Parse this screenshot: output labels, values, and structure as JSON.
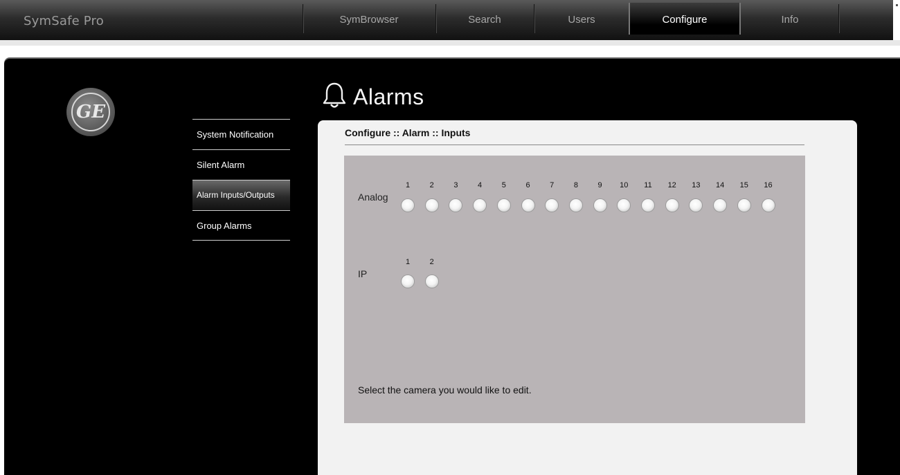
{
  "app": {
    "title": "SymSafe Pro"
  },
  "nav": {
    "tabs": [
      {
        "label": "SymBrowser",
        "active": false
      },
      {
        "label": "Search",
        "active": false
      },
      {
        "label": "Users",
        "active": false
      },
      {
        "label": "Configure",
        "active": true
      },
      {
        "label": "Info",
        "active": false
      }
    ]
  },
  "logo": {
    "text": "GE"
  },
  "sidebar": {
    "items": [
      {
        "label": "System Notification",
        "active": false
      },
      {
        "label": "Silent Alarm",
        "active": false
      },
      {
        "label": "Alarm Inputs/Outputs",
        "active": true
      },
      {
        "label": "Group Alarms",
        "active": false
      }
    ]
  },
  "page": {
    "title": "Alarms",
    "icon": "bell-icon",
    "breadcrumb": "Configure :: Alarm :: Inputs"
  },
  "inputs": {
    "analog": {
      "label": "Analog",
      "numbers": [
        "1",
        "2",
        "3",
        "4",
        "5",
        "6",
        "7",
        "8",
        "9",
        "10",
        "11",
        "12",
        "13",
        "14",
        "15",
        "16"
      ]
    },
    "ip": {
      "label": "IP",
      "numbers": [
        "1",
        "2"
      ]
    }
  },
  "hint": "Select the camera you would like to edit.",
  "colors": {
    "content_panel": "#f2f2f2",
    "grey_panel": "#b9b4b6",
    "main_background": "#000000"
  }
}
